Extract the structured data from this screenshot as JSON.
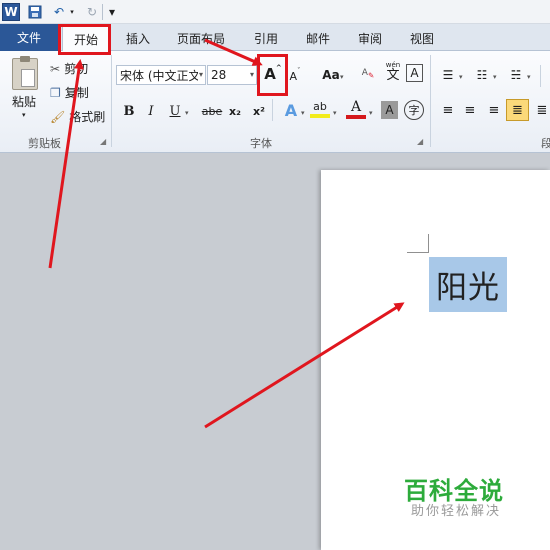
{
  "qat": {
    "app_icon": "W",
    "icons": [
      "save-icon",
      "undo-icon",
      "redo-icon",
      "customize-icon"
    ]
  },
  "tabs": {
    "file": "文件",
    "home": "开始",
    "insert": "插入",
    "layout": "页面布局",
    "references": "引用",
    "mailings": "邮件",
    "review": "审阅",
    "view": "视图"
  },
  "clipboard": {
    "paste": "粘贴",
    "cut": "剪切",
    "copy": "复制",
    "format_painter": "格式刷",
    "label": "剪贴板"
  },
  "font": {
    "font_name": "宋体 (中文正文",
    "font_size": "28",
    "grow": "A",
    "shrink": "A",
    "change_case": "Aa",
    "phonetic": "wén",
    "phonetic_char": "文",
    "border_char": "A",
    "bold": "B",
    "italic": "I",
    "underline": "U",
    "strike": "abe",
    "sub": "x₂",
    "sup": "x²",
    "text_effect": "A",
    "highlight": "ab",
    "font_color": "A",
    "shading": "A",
    "enclose": "字",
    "label": "字体"
  },
  "paragraph": {
    "label": "段"
  },
  "document": {
    "selected_text": "阳光"
  },
  "watermark": {
    "title": "百科全说",
    "subtitle": "助你轻松解决"
  },
  "colors": {
    "accent_red": "#e0161e",
    "ribbon_blue": "#2b5797",
    "selection": "#a8c8e8",
    "watermark_green": "#2dab3b"
  }
}
